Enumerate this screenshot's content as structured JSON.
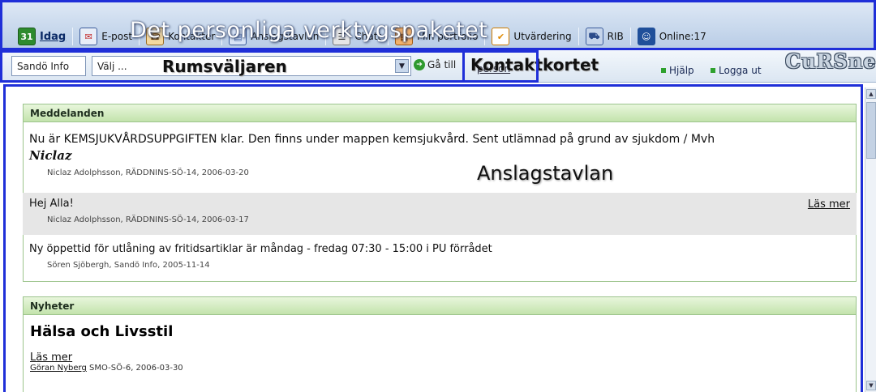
{
  "toolbar": {
    "overlay_title": "Det personliga verktygspaketet",
    "items": [
      {
        "label": "Idag",
        "icon": "calendar-icon",
        "glyph": "31"
      },
      {
        "label": "E-post",
        "icon": "mail-icon",
        "glyph": "✉"
      },
      {
        "label": "Kontakter",
        "icon": "contacts-icon",
        "glyph": "☎"
      },
      {
        "label": "Anslagstavlan",
        "icon": "board-icon",
        "glyph": "▤"
      },
      {
        "label": "Chatt",
        "icon": "chat-icon",
        "glyph": "☰"
      },
      {
        "label": "Min portfolio",
        "icon": "portfolio-icon",
        "glyph": "▦"
      },
      {
        "label": "Utvärdering",
        "icon": "check-icon",
        "glyph": "✔"
      },
      {
        "label": "RIB",
        "icon": "rib-icon",
        "glyph": "⛟"
      },
      {
        "label": "Online:17",
        "icon": "online-icon",
        "glyph": "☺"
      }
    ]
  },
  "navbar": {
    "site": "Sandö Info",
    "room_select_value": "Välj ...",
    "room_label": "Rumsväljaren",
    "goto": "Gå till",
    "person": "person",
    "contact_label": "Kontaktkortet",
    "help": "Hjälp",
    "logout": "Logga ut",
    "brand": "CuRSnet"
  },
  "board_label": "Anslagstavlan",
  "messages": {
    "heading": "Meddelanden",
    "items": [
      {
        "text": "Nu är KEMSJUKVÅRDSUPPGIFTEN klar. Den finns under mappen kemsjukvård. Sent utlämnad på grund av sjukdom  / Mvh",
        "signature": "Niclaz",
        "meta": "Niclaz Adolphsson,  RÄDDNINS-SÖ-14,  2006-03-20"
      },
      {
        "text": "Hej Alla!",
        "read_more": "Läs mer",
        "meta": "Niclaz Adolphsson,  RÄDDNINS-SÖ-14,  2006-03-17"
      },
      {
        "text": "Ny öppettid för utlåning av fritidsartiklar är måndag - fredag 07:30 - 15:00 i PU förrådet",
        "meta": "Sören Sjöbergh,  Sandö Info,  2005-11-14"
      }
    ]
  },
  "news": {
    "heading": "Nyheter",
    "title": "Hälsa och Livsstil",
    "read_more": "Läs mer",
    "author": "Göran Nyberg",
    "meta": " SMO-SÖ-6, 2006-03-30"
  },
  "colors": {
    "annotation": "#1f2fd8",
    "panel_header": "#c3e3ac",
    "toolbar": "#b9cde6"
  }
}
